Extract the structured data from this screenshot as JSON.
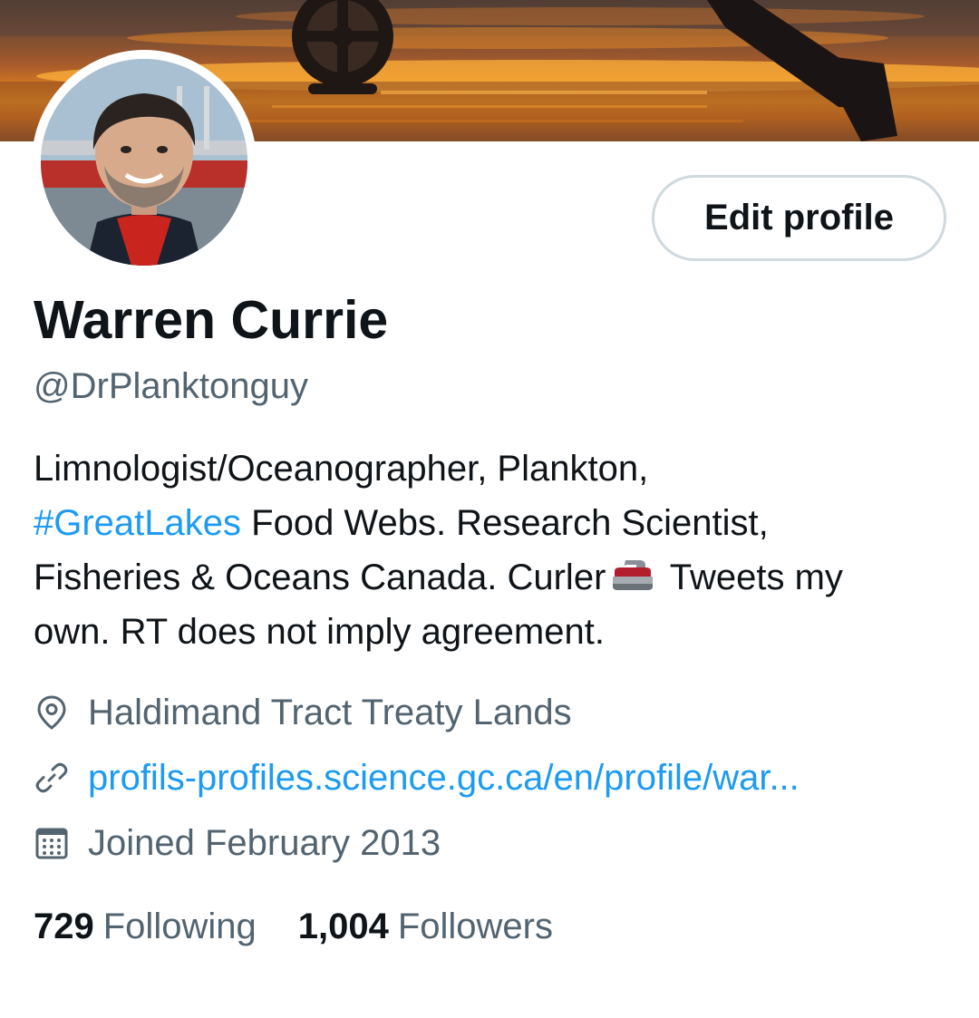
{
  "profile": {
    "display_name": "Warren Currie",
    "handle": "@DrPlanktonguy",
    "edit_button_label": "Edit profile",
    "bio": {
      "line1": "Limnologist/Oceanographer, Plankton,",
      "hashtag": "#GreatLakes",
      "line2_rest": " Food Webs. Research Scientist,",
      "line3_a": "Fisheries & Oceans Canada. Curler",
      "curling_emoji_icon": "curling-stone-icon",
      "line3_b": " Tweets my",
      "line4": "own. RT does not imply agreement."
    },
    "location": "Haldimand Tract Treaty Lands",
    "website": "profils-profiles.science.gc.ca/en/profile/war...",
    "joined": "Joined February 2013",
    "stats": {
      "following_count": "729",
      "following_label": "Following",
      "followers_count": "1,004",
      "followers_label": "Followers"
    }
  },
  "icons": {
    "location": "location-pin-icon",
    "website": "link-icon",
    "joined": "calendar-icon"
  },
  "colors": {
    "accent": "#1d9bf0",
    "text_primary": "#0f1419",
    "text_secondary": "#536471",
    "button_border": "#cfd9de"
  }
}
